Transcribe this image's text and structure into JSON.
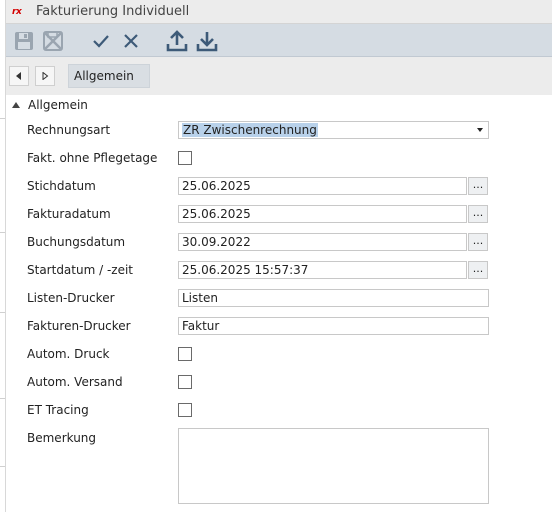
{
  "window": {
    "app_logo": "rx",
    "title": "Fakturierung Individuell"
  },
  "toolbar": {
    "buttons": [
      {
        "name": "save",
        "icon": "save-icon",
        "enabled": false
      },
      {
        "name": "discard",
        "icon": "discard-icon",
        "enabled": false
      },
      {
        "name": "confirm",
        "icon": "checkmark-icon",
        "enabled": true
      },
      {
        "name": "cancel",
        "icon": "close-icon",
        "enabled": true
      },
      {
        "name": "export",
        "icon": "upload-icon",
        "enabled": true
      },
      {
        "name": "import",
        "icon": "download-icon",
        "enabled": true
      }
    ],
    "icon_color_enabled": "#3d5a78",
    "icon_color_disabled": "#9aa5b0"
  },
  "nav": {
    "breadcrumb": "Allgemein"
  },
  "section": {
    "title": "Allgemein"
  },
  "form": {
    "rechnungsart": {
      "label": "Rechnungsart",
      "value": "ZR Zwischenrechnung"
    },
    "fakt_ohne_pflegetage": {
      "label": "Fakt. ohne Pflegetage",
      "checked": false
    },
    "stichdatum": {
      "label": "Stichdatum",
      "value": "25.06.2025",
      "button": "..."
    },
    "fakturadatum": {
      "label": "Fakturadatum",
      "value": "25.06.2025",
      "button": "..."
    },
    "buchungsdatum": {
      "label": "Buchungsdatum",
      "value": "30.09.2022",
      "button": "..."
    },
    "startdatum": {
      "label": "Startdatum / -zeit",
      "value": "25.06.2025 15:57:37",
      "button": "..."
    },
    "listen_drucker": {
      "label": "Listen-Drucker",
      "value": "Listen"
    },
    "fakturen_drucker": {
      "label": "Fakturen-Drucker",
      "value": "Faktur"
    },
    "autom_druck": {
      "label": "Autom. Druck",
      "checked": false
    },
    "autom_versand": {
      "label": "Autom. Versand",
      "checked": false
    },
    "et_tracing": {
      "label": "ET Tracing",
      "checked": false
    },
    "bemerkung": {
      "label": "Bemerkung",
      "value": ""
    }
  },
  "colors": {
    "toolbar_bg": "#d5dce3",
    "selection_highlight": "#b8d1ea"
  }
}
